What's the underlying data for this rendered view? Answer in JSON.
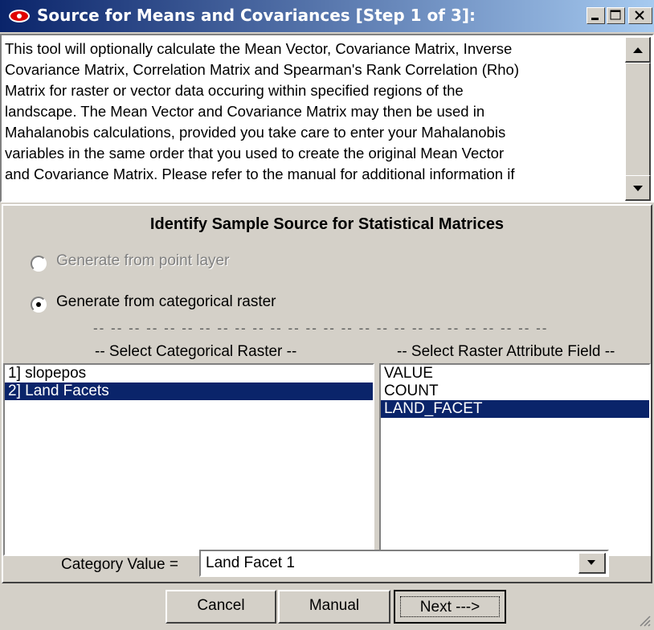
{
  "window": {
    "title": "Source for Means and Covariances [Step 1 of 3]:"
  },
  "description": {
    "text": "This tool will optionally calculate the Mean Vector, Covariance Matrix, Inverse\nCovariance Matrix, Correlation Matrix and Spearman's Rank Correlation (Rho)\nMatrix for raster or vector data occuring within specified regions of the\nlandscape.  The Mean Vector and Covariance Matrix may then be used in\nMahalanobis calculations, provided you take care to enter your Mahalanobis\nvariables in the same order that you used to create the original Mean Vector\nand Covariance Matrix.  Please refer to the manual for additional information if"
  },
  "section": {
    "heading": "Identify Sample Source for Statistical Matrices"
  },
  "options": {
    "point_layer": {
      "label": "Generate from point layer",
      "enabled": false,
      "checked": false
    },
    "categorical_raster": {
      "label": "Generate from categorical raster",
      "enabled": true,
      "checked": true
    }
  },
  "separator": "-- -- -- -- -- -- -- -- -- -- -- -- -- -- -- -- -- -- -- -- -- -- -- -- -- --",
  "raster_list": {
    "header": "-- Select Categorical Raster --",
    "items": [
      {
        "label": "1]  slopepos",
        "selected": false
      },
      {
        "label": "2]  Land Facets",
        "selected": true
      }
    ]
  },
  "field_list": {
    "header": "-- Select Raster Attribute Field --",
    "items": [
      {
        "label": "VALUE",
        "selected": false
      },
      {
        "label": "COUNT",
        "selected": false
      },
      {
        "label": "LAND_FACET",
        "selected": true
      }
    ]
  },
  "category": {
    "label": "Category Value =",
    "value": "Land Facet 1"
  },
  "buttons": {
    "cancel": "Cancel",
    "manual": "Manual",
    "next": "Next --->"
  },
  "colors": {
    "title_bar_start": "#0a246a",
    "title_bar_end": "#a6caf0",
    "selection": "#0a246a",
    "dialog_face": "#d4d0c8",
    "disabled_text": "#808080"
  },
  "icons": {
    "app": "eye-icon",
    "minimize": "minimize-icon",
    "maximize": "maximize-icon",
    "close": "close-icon"
  }
}
